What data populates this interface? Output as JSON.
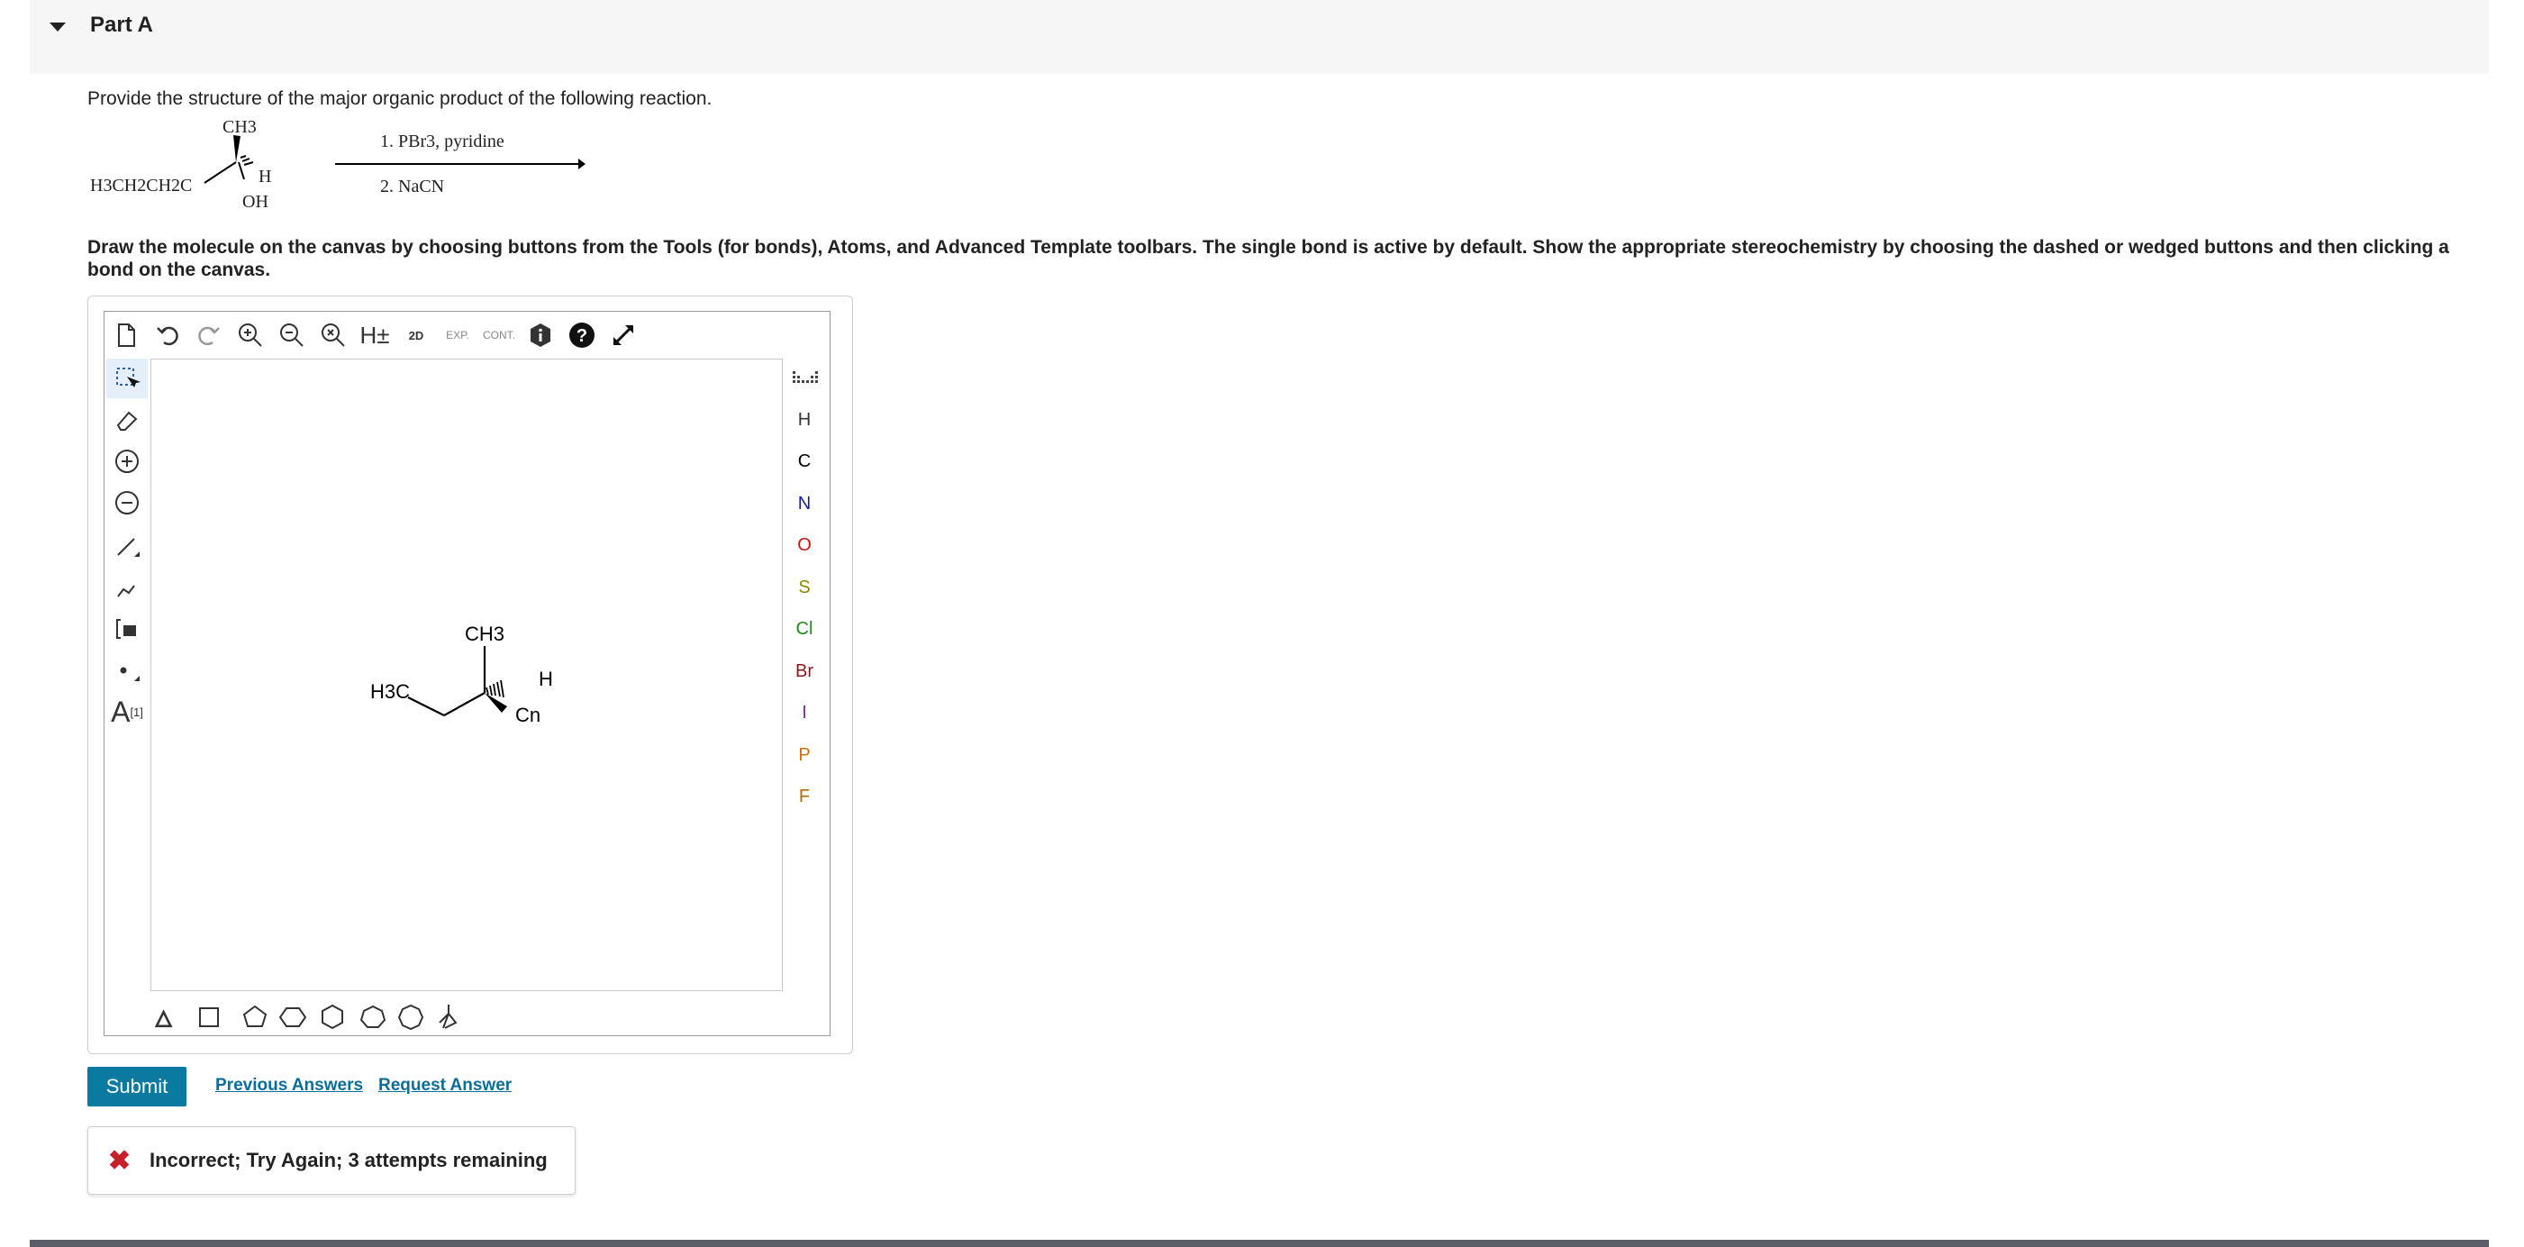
{
  "part": {
    "title": "Part A"
  },
  "question": {
    "text": "Provide the structure of the major organic product of the following reaction."
  },
  "reaction": {
    "ch3_top": "CH3",
    "substituent": "H3CH2CH2C",
    "h_label": "H",
    "oh_label": "OH",
    "step1": "1. PBr3, pyridine",
    "step2": "2. NaCN"
  },
  "instructions": "Draw the molecule on the canvas by choosing buttons from the Tools (for bonds), Atoms, and Advanced Template toolbars. The single bond is active by default. Show the appropriate stereochemistry by choosing the dashed or wedged buttons and then clicking a bond on the canvas.",
  "toolbar": {
    "h_toggle": "H±",
    "two_d": "2D",
    "exp": "EXP.",
    "cont": "CONT."
  },
  "left_tools": {
    "charge_label": "A",
    "charge_index": "[1]"
  },
  "atoms": [
    "H",
    "C",
    "N",
    "O",
    "S",
    "Cl",
    "Br",
    "I",
    "P",
    "F"
  ],
  "atom_colors": [
    "#333333",
    "#000000",
    "#1b1b9a",
    "#d01010",
    "#8a8a00",
    "#1e8a1e",
    "#8a1a1a",
    "#7a2aa0",
    "#d07000",
    "#b06a00"
  ],
  "molecule": {
    "h3c": "H3C",
    "ch3": "CH3",
    "h": "H",
    "cn": "Cn"
  },
  "actions": {
    "submit": "Submit",
    "previous_answers": "Previous Answers",
    "request_answer": "Request Answer"
  },
  "feedback": {
    "message": "Incorrect; Try Again; 3 attempts remaining"
  }
}
